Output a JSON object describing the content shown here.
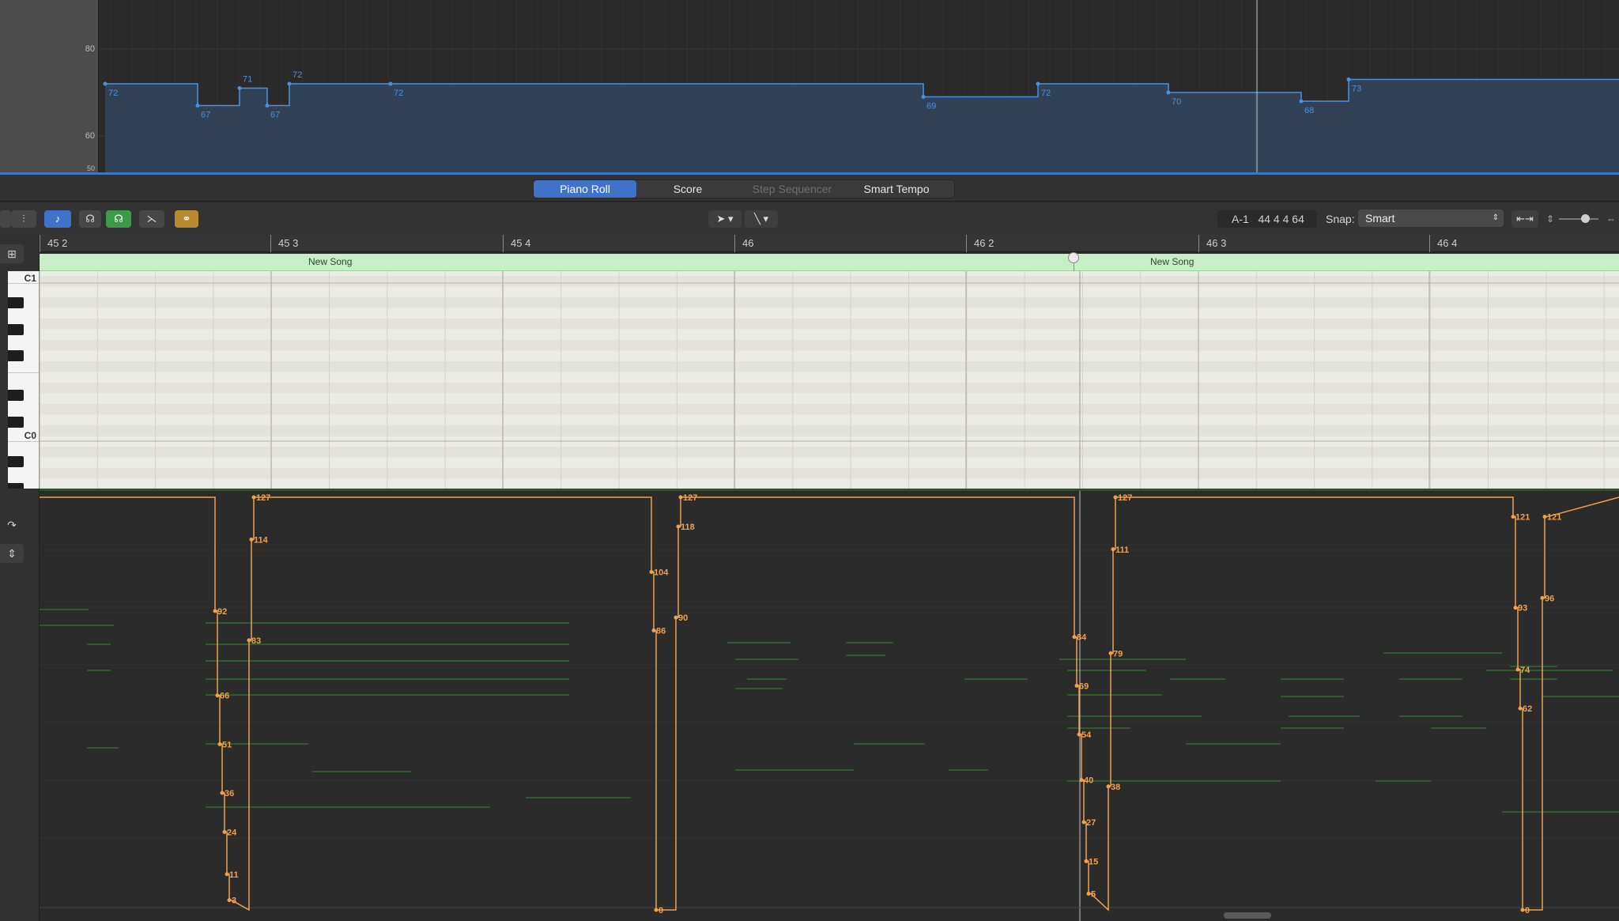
{
  "tempo_track": {
    "y_labels": [
      "80",
      "60",
      "50"
    ],
    "points": [
      {
        "value": 72,
        "label": "72"
      },
      {
        "value": 67,
        "label": "67"
      },
      {
        "value": 71,
        "label": "71"
      },
      {
        "value": 67,
        "label": "67"
      },
      {
        "value": 72,
        "label": "72"
      },
      {
        "value": 72,
        "label": "72"
      },
      {
        "value": 69,
        "label": "69"
      },
      {
        "value": 72,
        "label": "72"
      },
      {
        "value": 70,
        "label": "70"
      },
      {
        "value": 68,
        "label": "68"
      },
      {
        "value": 73,
        "label": "73"
      }
    ]
  },
  "tabs": [
    {
      "label": "Piano Roll",
      "state": "active"
    },
    {
      "label": "Score",
      "state": "normal"
    },
    {
      "label": "Step Sequencer",
      "state": "disabled"
    },
    {
      "label": "Smart Tempo",
      "state": "normal"
    }
  ],
  "toolbar": {
    "lcd_note": "A-1",
    "lcd_position": "44 4 4 64",
    "snap_label": "Snap:",
    "snap_value": "Smart"
  },
  "ruler": {
    "bars": [
      "45 2",
      "45 3",
      "45 4",
      "46",
      "46 2",
      "46 3",
      "46 4"
    ]
  },
  "regions": [
    {
      "name": "New Song"
    },
    {
      "name": "New Song"
    }
  ],
  "piano_keys": {
    "labels": [
      "C1",
      "C0"
    ]
  },
  "velocity_lane": {
    "groups": [
      {
        "values": [
          92,
          66,
          51,
          36,
          24,
          11,
          3
        ],
        "rise": [
          83,
          114,
          127
        ]
      },
      {
        "values": [
          104,
          86,
          0
        ],
        "rise": [
          90,
          118,
          127
        ]
      },
      {
        "values": [
          84,
          69,
          54,
          40,
          27,
          15,
          5
        ],
        "rise": [
          38,
          79,
          111,
          127
        ]
      },
      {
        "values": [
          121,
          93,
          74,
          62,
          0
        ],
        "rise": [
          96,
          121
        ]
      }
    ],
    "labels": [
      "127",
      "114",
      "83",
      "92",
      "66",
      "51",
      "36",
      "24",
      "11",
      "3",
      "127",
      "118",
      "104",
      "90",
      "86",
      "0",
      "127",
      "111",
      "84",
      "79",
      "69",
      "54",
      "40",
      "38",
      "27",
      "15",
      "5",
      "121",
      "121",
      "96",
      "93",
      "74",
      "62",
      "0"
    ]
  },
  "colors": {
    "accent_blue": "#3f72c8",
    "tempo_line": "#4a90e2",
    "velocity_line": "#f0a24a",
    "region_green": "#c6efc6"
  }
}
